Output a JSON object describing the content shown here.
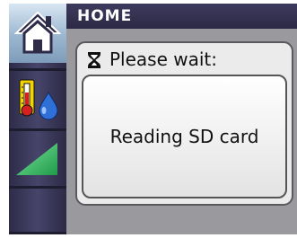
{
  "header": {
    "title": "HOME"
  },
  "sidebar": {
    "items": [
      {
        "icon": "home-icon",
        "selected": true
      },
      {
        "icon": "temperature-humidity-icon",
        "selected": false
      },
      {
        "icon": "level-ramp-icon",
        "selected": false
      },
      {
        "icon": "",
        "selected": false
      }
    ]
  },
  "dialog": {
    "title": "Please wait:",
    "icon": "hourglass-icon",
    "message": "Reading SD card"
  },
  "colors": {
    "sidebar_bg": "#3a3858",
    "selected_bg": "#a9c2da",
    "main_bg": "#9a9a9e",
    "dialog_bg": "#ebebeb"
  }
}
